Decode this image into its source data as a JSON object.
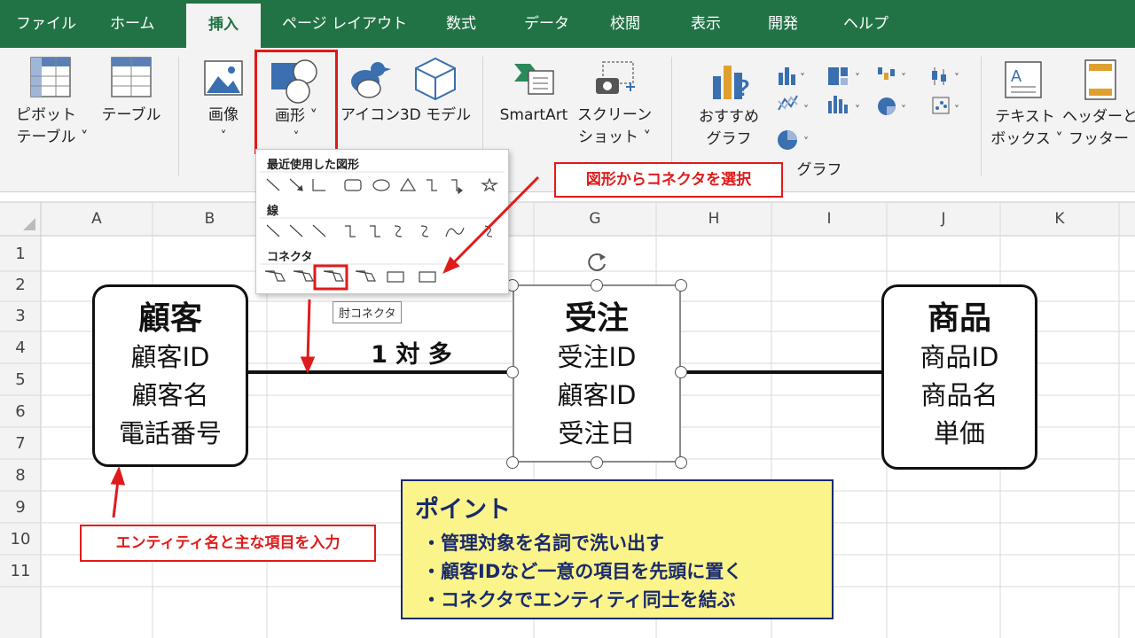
{
  "ribbon_tabs": [
    "ファイル",
    "ホーム",
    "挿入",
    "ページ レイアウト",
    "数式",
    "データ",
    "校閲",
    "表示",
    "開発",
    "ヘルプ"
  ],
  "active_tab": "挿入",
  "ribbon": {
    "pivot_line1": "ピボット",
    "pivot_line2": "テーブル ˅",
    "table": "テーブル",
    "image": "画像",
    "image_caret": "˅",
    "shape": "画形 ˅",
    "shape_caret": "˅",
    "icon": "アイコン",
    "model3d": "3D モデル",
    "smartart": "SmartArt",
    "screenshot_line1": "スクリーン",
    "screenshot_line2": "ショット ˅",
    "rec_chart_line1": "おすすめ",
    "rec_chart_line2": "グラフ",
    "chart_group": "グラフ",
    "textbox_line1": "テキスト",
    "textbox_line2": "ボックス ˅",
    "header_line1": "ヘッダーと",
    "header_line2": "フッター"
  },
  "dropdown": {
    "recent_header": "最近使用した図形",
    "lines_header": "線",
    "connector_header": "コネクタ",
    "tooltip": "肘コネクタ"
  },
  "columns": [
    "A",
    "B",
    "G",
    "H",
    "I",
    "J",
    "K"
  ],
  "rows": [
    "1",
    "2",
    "3",
    "4",
    "5",
    "6",
    "7",
    "8",
    "9",
    "10",
    "11"
  ],
  "entities": {
    "customer": {
      "title": "顧客",
      "attrs": [
        "顧客ID",
        "顧客名",
        "電話番号"
      ]
    },
    "order": {
      "title": "受注",
      "attrs": [
        "受注ID",
        "顧客ID",
        "受注日"
      ]
    },
    "product": {
      "title": "商品",
      "attrs": [
        "商品ID",
        "商品名",
        "単価"
      ]
    }
  },
  "relation_label": "1 対 多",
  "callouts": {
    "connector": "図形からコネクタを選択",
    "entity": "エンティティ名と主な項目を入力"
  },
  "point": {
    "title": "ポイント",
    "items": [
      "・管理対象を名詞で洗い出す",
      "・顧客IDなど一意の項目を先頭に置く",
      "・コネクタでエンティティ同士を結ぶ"
    ]
  },
  "colors": {
    "excel_green": "#217346",
    "highlight_red": "#e01b1b",
    "point_yellow": "#fbf48a",
    "point_navy": "#1a2a6c"
  }
}
